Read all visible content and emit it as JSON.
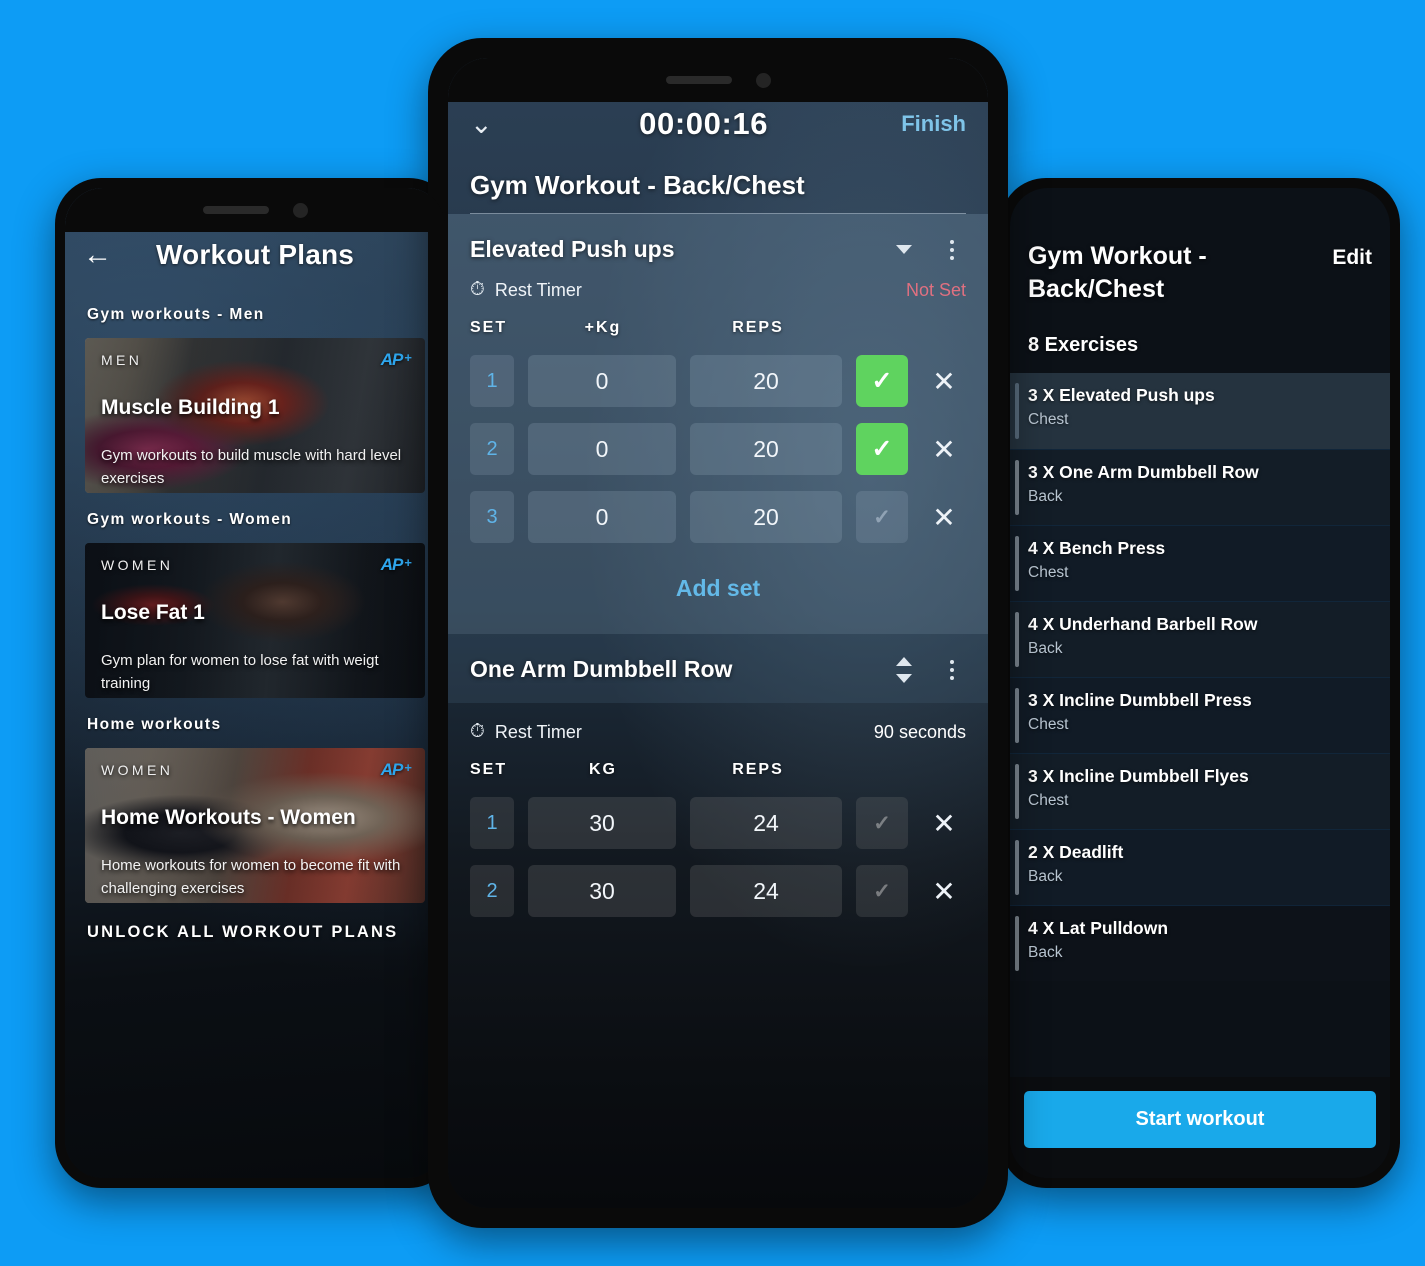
{
  "theme": {
    "background": "#0d9cf5",
    "accent_blue": "#19a9ea",
    "link_blue": "#7fc4e8",
    "check_green": "#5fd35f",
    "alert_red": "#e07080"
  },
  "left_phone": {
    "screen_name": "workout-plans",
    "header": {
      "back_icon": "back-arrow-icon",
      "title": "Workout Plans"
    },
    "sections": [
      {
        "label": "Gym workouts - Men",
        "card": {
          "kicker": "MEN",
          "name": "Muscle Building 1",
          "description": "Gym workouts to build muscle with hard level exercises",
          "badge": "AP",
          "badge_plus": "+"
        }
      },
      {
        "label": "Gym workouts - Women",
        "card": {
          "kicker": "WOMEN",
          "name": "Lose Fat 1",
          "description": "Gym plan for women to lose fat with weigt training",
          "badge": "AP",
          "badge_plus": "+"
        }
      },
      {
        "label": "Home workouts",
        "card": {
          "kicker": "WOMEN",
          "name": "Home Workouts - Women",
          "description": "Home workouts for women to become fit with challenging exercises",
          "badge": "AP",
          "badge_plus": "+"
        }
      }
    ],
    "unlock_label": "UNLOCK ALL WORKOUT PLANS"
  },
  "center_phone": {
    "screen_name": "active-workout",
    "topbar": {
      "collapse_icon": "chevron-down-icon",
      "timer": "00:00:16",
      "finish_label": "Finish"
    },
    "workout_name": "Gym Workout - Back/Chest",
    "exercises": [
      {
        "name": "Elevated Push ups",
        "rest_timer_label": "Rest Timer",
        "rest_timer_value": "Not Set",
        "rest_timer_state": "notset",
        "columns": {
          "set": "SET",
          "weight": "+Kg",
          "reps": "REPS"
        },
        "sets": [
          {
            "index": "1",
            "weight": "0",
            "reps": "20",
            "done": true
          },
          {
            "index": "2",
            "weight": "0",
            "reps": "20",
            "done": true
          },
          {
            "index": "3",
            "weight": "0",
            "reps": "20",
            "done": false
          }
        ],
        "add_set_label": "Add set"
      },
      {
        "name": "One Arm Dumbbell Row",
        "rest_timer_label": "Rest Timer",
        "rest_timer_value": "90 seconds",
        "rest_timer_state": "set",
        "columns": {
          "set": "SET",
          "weight": "KG",
          "reps": "REPS"
        },
        "sets": [
          {
            "index": "1",
            "weight": "30",
            "reps": "24",
            "done": false
          },
          {
            "index": "2",
            "weight": "30",
            "reps": "24",
            "done": false
          }
        ]
      }
    ]
  },
  "right_phone": {
    "screen_name": "workout-detail",
    "title": "Gym Workout - Back/Chest",
    "edit_label": "Edit",
    "exercise_count": "8 Exercises",
    "exercises": [
      {
        "name": "3 X Elevated Push ups",
        "group": "Chest"
      },
      {
        "name": "3 X One Arm Dumbbell Row",
        "group": "Back"
      },
      {
        "name": "4 X Bench Press",
        "group": "Chest"
      },
      {
        "name": "4 X Underhand Barbell Row",
        "group": "Back"
      },
      {
        "name": "3 X Incline Dumbbell Press",
        "group": "Chest"
      },
      {
        "name": "3 X Incline Dumbbell Flyes",
        "group": "Chest"
      },
      {
        "name": "2 X Deadlift",
        "group": "Back"
      },
      {
        "name": "4 X Lat Pulldown",
        "group": "Back"
      }
    ],
    "start_label": "Start workout"
  }
}
